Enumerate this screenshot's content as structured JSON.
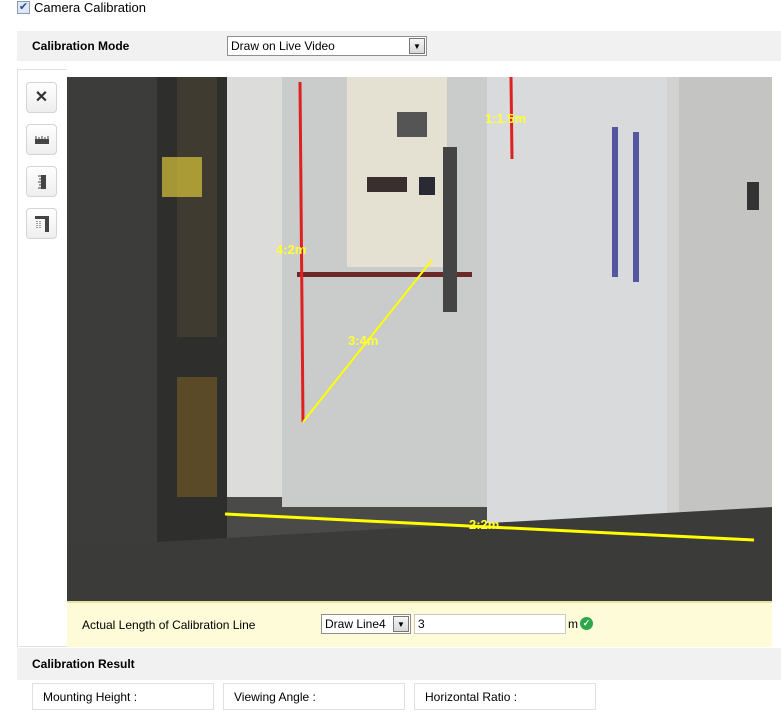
{
  "camera_calibration": {
    "label": "Camera Calibration",
    "checked": true
  },
  "calibration_mode": {
    "label": "Calibration Mode",
    "value": "Draw on Live Video"
  },
  "toolbar": [
    {
      "icon": "close-icon"
    },
    {
      "icon": "horizontal-ruler-icon"
    },
    {
      "icon": "vertical-ruler-icon"
    },
    {
      "icon": "verify-ruler-icon"
    }
  ],
  "video": {
    "lines": [
      {
        "label": "1:1.5m",
        "color": "#e02020"
      },
      {
        "label": "2:2m",
        "color": "#ffff00"
      },
      {
        "label": "3:4m",
        "color": "#ffff00"
      },
      {
        "label": "4:2m",
        "color": "#e02020"
      }
    ]
  },
  "calibration_line": {
    "label": "Actual Length of Calibration Line",
    "selected": "Draw Line4",
    "value": "3",
    "unit": "m",
    "status": "valid"
  },
  "result": {
    "title": "Calibration Result",
    "mounting_height": "Mounting Height :",
    "viewing_angle": "Viewing Angle :",
    "horizontal_ratio": "Horizontal Ratio :"
  }
}
